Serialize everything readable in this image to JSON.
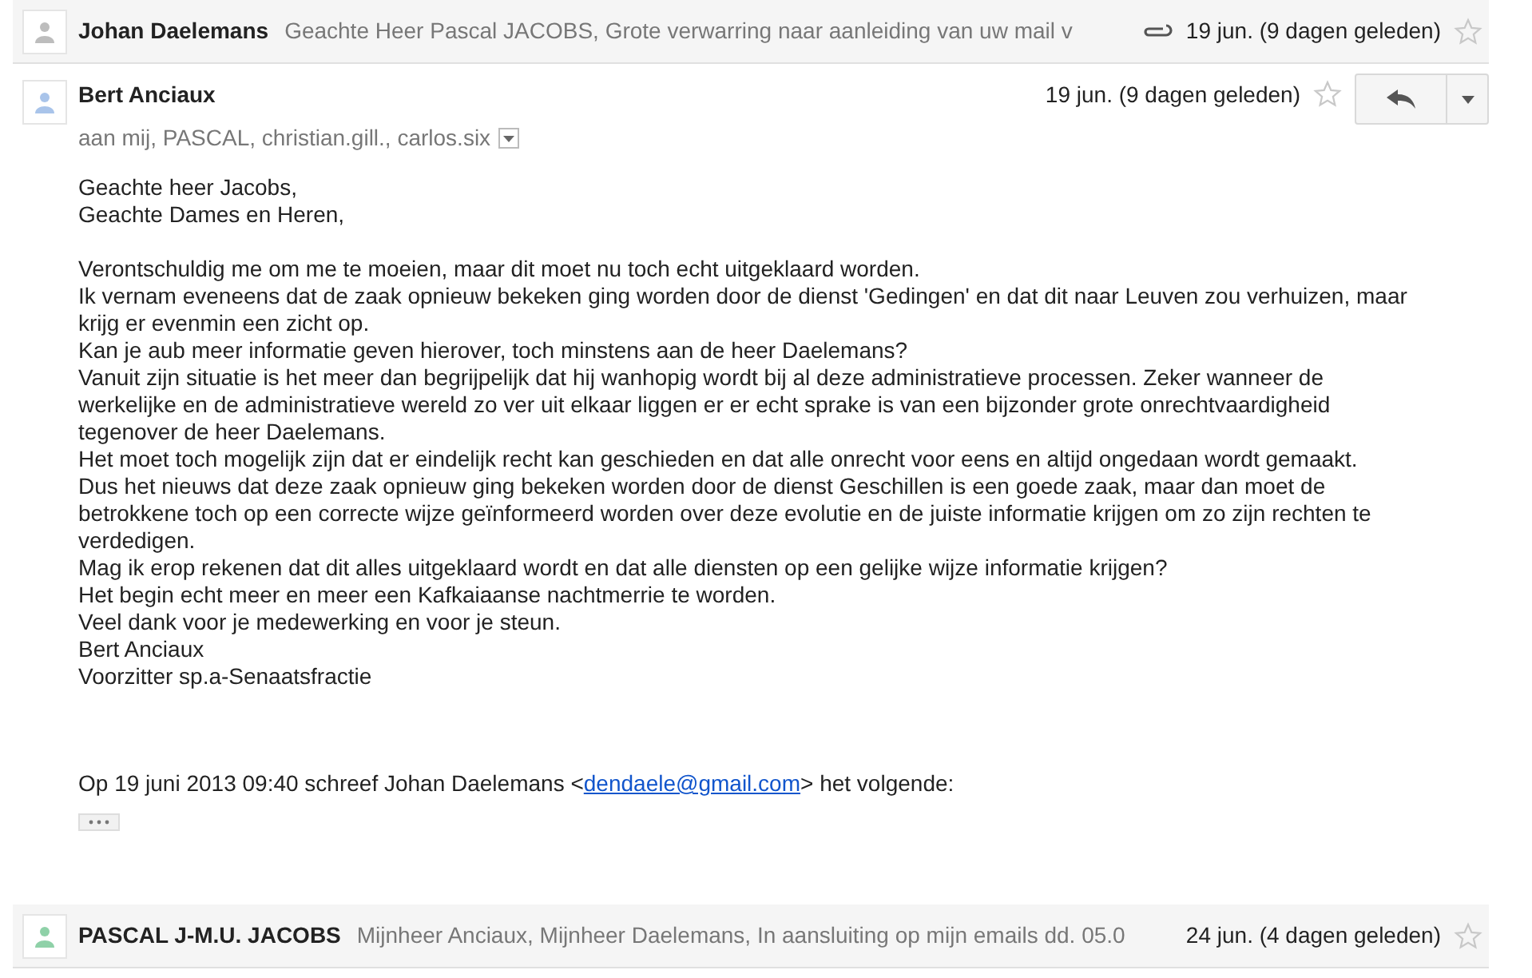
{
  "messages": [
    {
      "kind": "collapsed",
      "sender": "Johan Daelemans",
      "snippet": "Geachte Heer Pascal JACOBS, Grote verwarring naar aanleiding van uw mail v",
      "attachment": true,
      "date": "19 jun. (9 dagen geleden)",
      "starred": false,
      "color": "#bdbdbd"
    },
    {
      "kind": "expanded",
      "sender": "Bert Anciaux",
      "recipients": "aan mij, PASCAL, christian.gill., carlos.six",
      "date": "19 jun. (9 dagen geleden)",
      "starred": false,
      "color": "#a9c4ea",
      "body": [
        [
          "Geachte heer Jacobs,",
          "Geachte Dames en Heren,"
        ],
        [
          "Verontschuldig me om me te moeien, maar dit moet nu toch echt uitgeklaard worden.",
          "Ik vernam eveneens dat de zaak opnieuw bekeken ging worden door de dienst 'Gedingen' en dat dit naar Leuven zou verhuizen, maar krijg er evenmin een zicht op.",
          "Kan je aub meer informatie geven hierover, toch minstens aan de heer Daelemans?",
          "Vanuit zijn situatie is het meer dan begrijpelijk dat hij wanhopig wordt bij al deze administratieve processen. Zeker wanneer de werkelijke en de administratieve wereld zo ver uit elkaar liggen er er echt sprake is van een bijzonder grote onrechtvaardigheid tegenover de heer Daelemans.",
          "Het moet toch mogelijk zijn dat er eindelijk recht kan geschieden en dat alle onrecht voor eens en altijd ongedaan wordt gemaakt.",
          "Dus het nieuws dat deze zaak opnieuw ging bekeken worden door de dienst Geschillen is een goede zaak, maar dan moet de betrokkene toch op een correcte wijze geïnformeerd worden over deze evolutie en de juiste informatie krijgen om zo zijn rechten te verdedigen.",
          "Mag ik erop rekenen dat dit alles uitgeklaard wordt en dat alle diensten op een gelijke wijze informatie krijgen?",
          "Het begin echt meer en meer een Kafkaiaanse nachtmerrie te worden.",
          "Veel dank voor je medewerking en voor je steun.",
          "Bert Anciaux",
          "Voorzitter sp.a-Senaatsfractie"
        ]
      ],
      "quote": {
        "before": "Op 19 juni 2013 09:40 schreef Johan Daelemans <",
        "link": "dendaele@gmail.com",
        "after": "> het volgende:"
      }
    },
    {
      "kind": "collapsed",
      "sender": "PASCAL J-M.U. JACOBS",
      "snippet": "Mijnheer Anciaux, Mijnheer Daelemans, In aansluiting op mijn emails dd. 05.0",
      "attachment": false,
      "date": "24 jun. (4 dagen geleden)",
      "starred": false,
      "color": "#8fd1a8"
    }
  ]
}
